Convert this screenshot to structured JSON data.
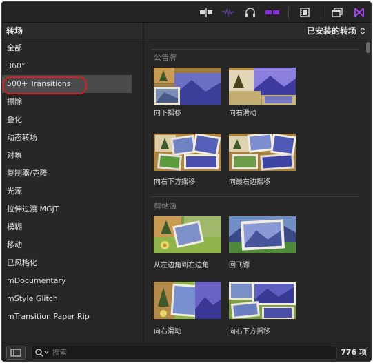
{
  "sidebar": {
    "title": "转场",
    "items": [
      {
        "label": "全部"
      },
      {
        "label": "360°"
      },
      {
        "label": "500+ Transitions"
      },
      {
        "label": "擦除"
      },
      {
        "label": "叠化"
      },
      {
        "label": "动态转场"
      },
      {
        "label": "对象"
      },
      {
        "label": "复制器/克隆"
      },
      {
        "label": "光源"
      },
      {
        "label": "拉伸过渡 MGJT"
      },
      {
        "label": "模糊"
      },
      {
        "label": "移动"
      },
      {
        "label": "已风格化"
      },
      {
        "label": "mDocumentary"
      },
      {
        "label": "mStyle Glitch"
      },
      {
        "label": "mTransition Paper Rip"
      }
    ],
    "selected_index": 2
  },
  "main": {
    "filter_label": "已安装的转场",
    "sections": [
      {
        "title": "公告牌",
        "items": [
          {
            "label": "向下摇移"
          },
          {
            "label": "向右滑动"
          },
          {
            "label": "向右下方摇移"
          },
          {
            "label": "向最右边摇移"
          }
        ]
      },
      {
        "title": "剪帖簿",
        "items": [
          {
            "label": "从左边角到右边角"
          },
          {
            "label": "回飞镖"
          },
          {
            "label": "向右滑动"
          },
          {
            "label": "向右下方摇移"
          }
        ]
      }
    ]
  },
  "bottom": {
    "search_placeholder": "搜索",
    "count": "776 项"
  },
  "colors": {
    "accent_purple": "#8a2be2",
    "highlight_red": "#d42020",
    "selected_bg": "#4b4b4b"
  }
}
